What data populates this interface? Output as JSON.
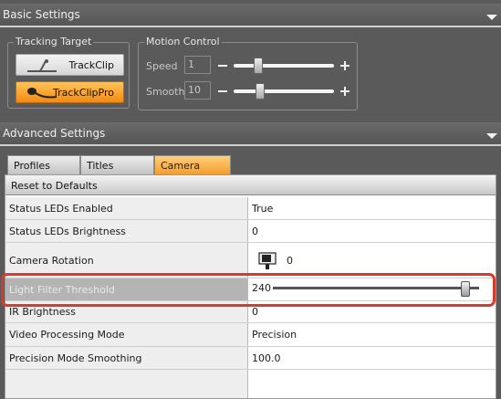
{
  "basic_settings": {
    "title": "Basic Settings"
  },
  "tracking_target": {
    "legend": "Tracking Target",
    "buttons": [
      {
        "label": "TrackClip",
        "state": "normal"
      },
      {
        "label": "TrackClipPro",
        "state": "active"
      }
    ]
  },
  "motion_control": {
    "legend": "Motion Control",
    "speed": {
      "label": "Speed",
      "value": "1",
      "slider_fraction": 0.23
    },
    "smooth": {
      "label": "Smooth",
      "value": "10",
      "slider_fraction": 0.19
    }
  },
  "advanced_settings": {
    "title": "Advanced Settings"
  },
  "tabs": [
    {
      "label": "Profiles",
      "active": false
    },
    {
      "label": "Titles",
      "active": false
    },
    {
      "label": "Camera",
      "active": true
    }
  ],
  "reset_label": "Reset to Defaults",
  "properties": [
    {
      "name": "Status LEDs Enabled",
      "value": "True"
    },
    {
      "name": "Status LEDs Brightness",
      "value": "0"
    },
    {
      "name": "Camera Rotation",
      "value": "0"
    },
    {
      "name": "Light Filter Threshold",
      "value": "240"
    },
    {
      "name": "IR Brightness",
      "value": "0"
    },
    {
      "name": "Video Processing Mode",
      "value": "Precision"
    },
    {
      "name": "Precision Mode Smoothing",
      "value": "100.0"
    }
  ],
  "colors": {
    "accent_orange": "#f48a12",
    "highlight_red": "#d93a2b",
    "background": "#5a5a5a"
  }
}
